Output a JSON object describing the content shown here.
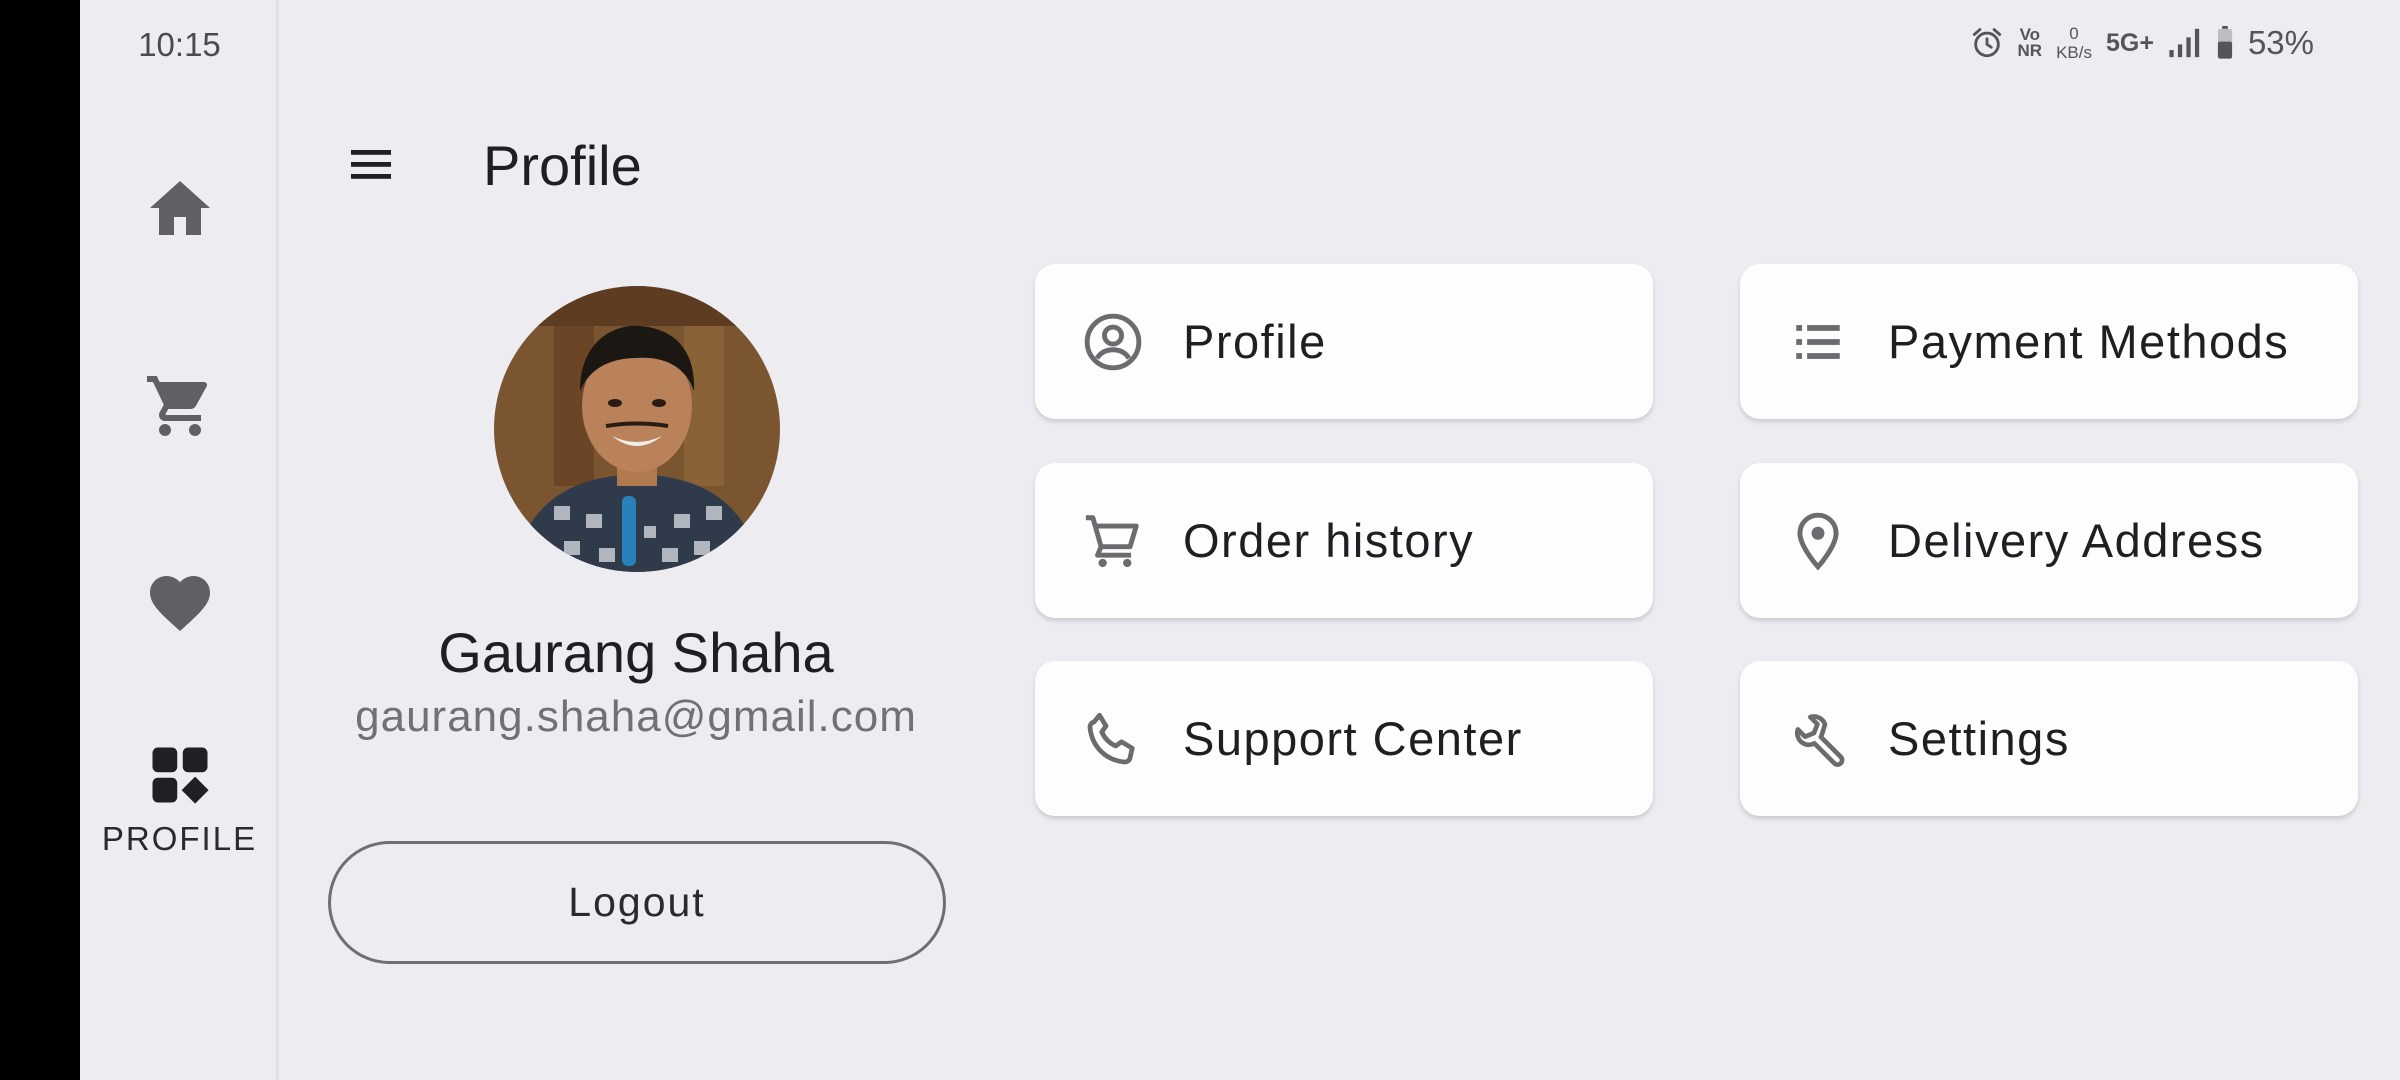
{
  "status_bar": {
    "time": "10:15",
    "volte_top": "Vo",
    "volte_bottom": "NR",
    "speed_value": "0",
    "speed_unit": "KB/s",
    "network": "5G+",
    "battery": "53%"
  },
  "nav_rail": {
    "items": [
      {
        "icon": "home-icon",
        "label": ""
      },
      {
        "icon": "cart-icon",
        "label": ""
      },
      {
        "icon": "heart-icon",
        "label": ""
      },
      {
        "icon": "dashboard-icon",
        "label": "PROFILE",
        "selected": true
      }
    ]
  },
  "header": {
    "title": "Profile"
  },
  "user": {
    "name": "Gaurang Shaha",
    "email": "gaurang.shaha@gmail.com"
  },
  "logout_label": "Logout",
  "menu_cards": [
    {
      "label": "Profile",
      "icon": "account-circle-icon"
    },
    {
      "label": "Payment Methods",
      "icon": "list-icon"
    },
    {
      "label": "Order history",
      "icon": "cart-outline-icon"
    },
    {
      "label": "Delivery Address",
      "icon": "location-pin-icon"
    },
    {
      "label": "Support Center",
      "icon": "phone-icon"
    },
    {
      "label": "Settings",
      "icon": "wrench-icon"
    }
  ],
  "colors": {
    "background": "#ececf1",
    "card": "#fdfdfd",
    "icon": "#6b6b70",
    "text": "#1f1f23"
  }
}
